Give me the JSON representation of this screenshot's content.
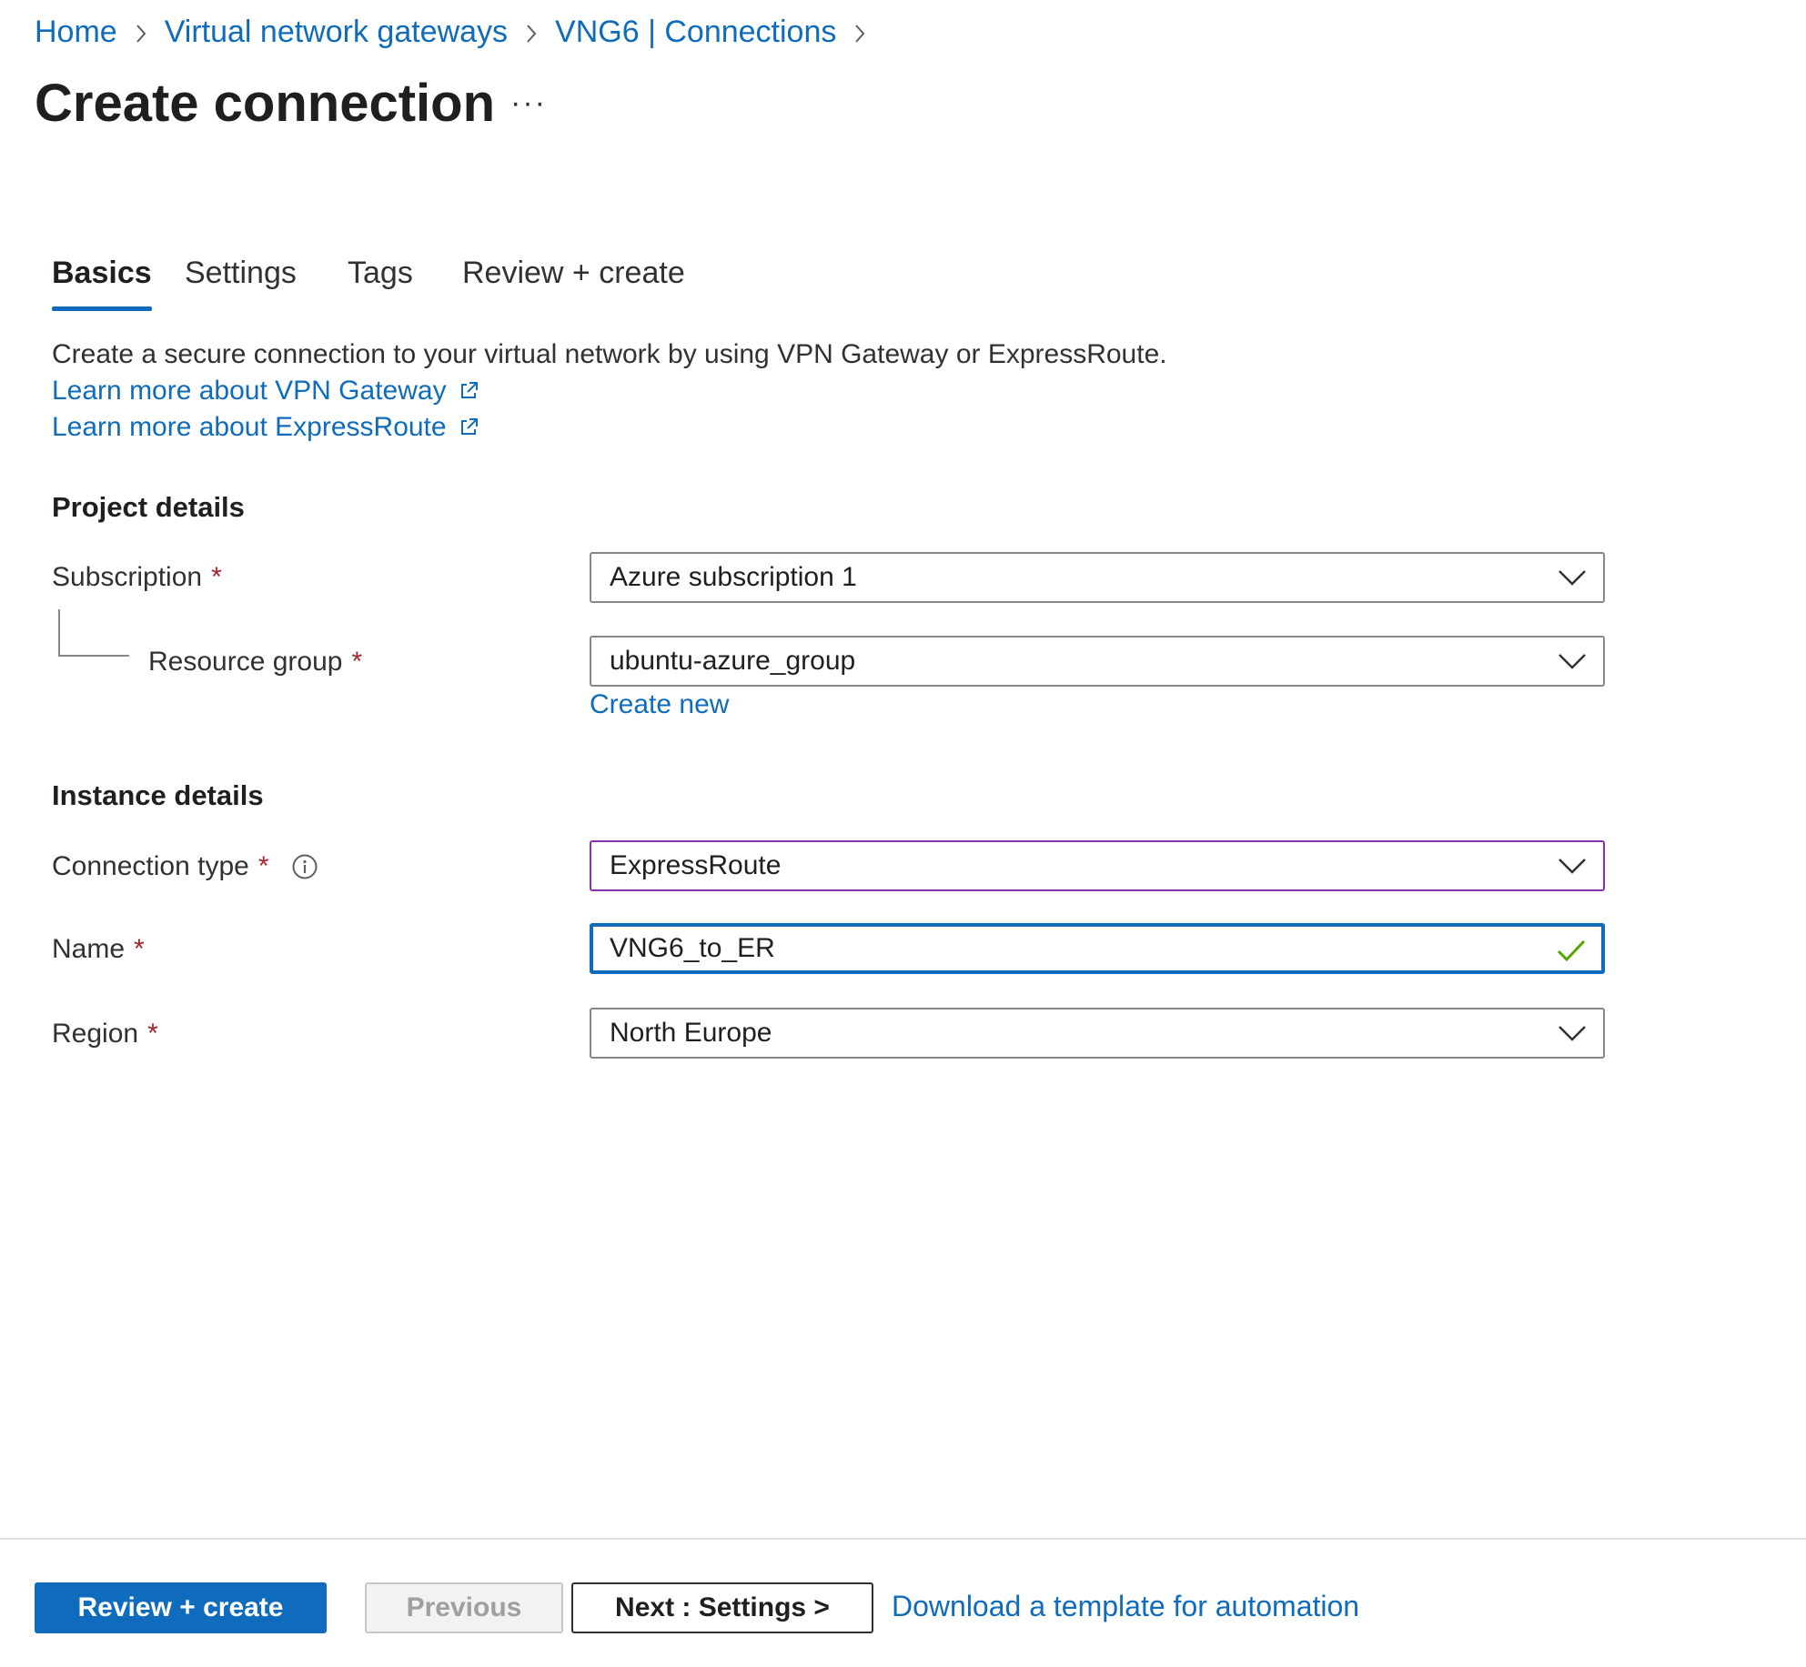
{
  "breadcrumb": {
    "items": [
      "Home",
      "Virtual network gateways",
      "VNG6 | Connections"
    ]
  },
  "page": {
    "title": "Create connection",
    "more": "···"
  },
  "tabs": [
    {
      "label": "Basics",
      "active": true
    },
    {
      "label": "Settings",
      "active": false
    },
    {
      "label": "Tags",
      "active": false
    },
    {
      "label": "Review + create",
      "active": false
    }
  ],
  "intro": {
    "description": "Create a secure connection to your virtual network by using VPN Gateway or ExpressRoute.",
    "link_vpn": "Learn more about VPN Gateway",
    "link_er": "Learn more about ExpressRoute"
  },
  "project_details": {
    "header": "Project details",
    "subscription": {
      "label": "Subscription",
      "required": "*",
      "value": "Azure subscription 1"
    },
    "resource_group": {
      "label": "Resource group",
      "required": "*",
      "value": "ubuntu-azure_group",
      "create_new": "Create new"
    }
  },
  "instance_details": {
    "header": "Instance details",
    "connection_type": {
      "label": "Connection type",
      "required": "*",
      "value": "ExpressRoute"
    },
    "name": {
      "label": "Name",
      "required": "*",
      "value": "VNG6_to_ER"
    },
    "region": {
      "label": "Region",
      "required": "*",
      "value": "North Europe"
    }
  },
  "footer": {
    "review_create": "Review + create",
    "previous": "Previous",
    "next": "Next : Settings >",
    "download": "Download a template for automation"
  },
  "colors": {
    "accent": "#0f6cbd",
    "required": "#a4262c",
    "valid": "#57a300",
    "connection_type_border": "#8c2fb0"
  },
  "icons": [
    "chevron-right-icon",
    "more-icon",
    "external-link-icon",
    "chevron-down-icon",
    "info-icon",
    "checkmark-icon"
  ]
}
